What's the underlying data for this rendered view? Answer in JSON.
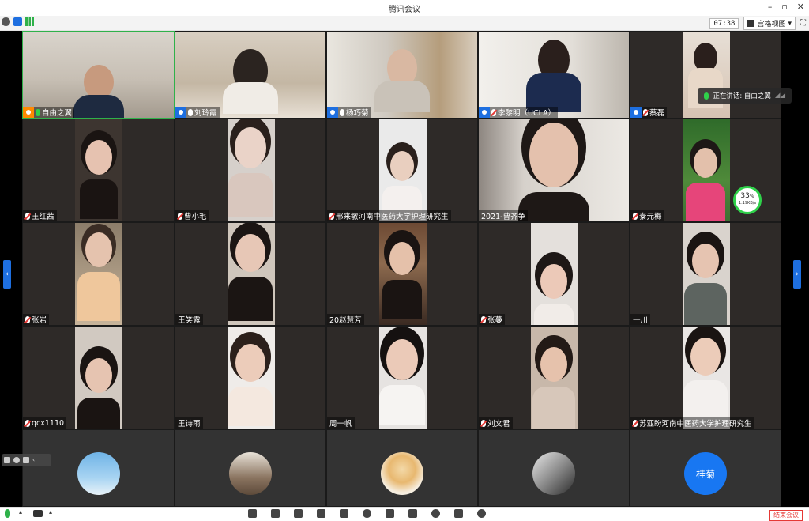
{
  "window": {
    "title": "腾讯会议"
  },
  "toolbar": {
    "time": "07:38",
    "view_label": "宫格视图"
  },
  "speaking": {
    "label": "正在讲话: 自由之翼"
  },
  "tiles": [
    {
      "name": "自由之翼",
      "role": "host",
      "mic": "green"
    },
    {
      "name": "刘玲霞",
      "role": "co",
      "mic": "on"
    },
    {
      "name": "杨巧菊",
      "role": "co",
      "mic": "on"
    },
    {
      "name": "李黎明（UCLA）",
      "role": "co",
      "mic": "muted"
    },
    {
      "name": "蔡磊",
      "role": "co",
      "mic": "muted"
    },
    {
      "name": "王红茜",
      "role": "",
      "mic": "muted"
    },
    {
      "name": "曹小毛",
      "role": "",
      "mic": "muted"
    },
    {
      "name": "邢来敏河南中医药大学护理研究生",
      "role": "",
      "mic": "muted"
    },
    {
      "name": "2021-曹齐争",
      "role": "",
      "mic": ""
    },
    {
      "name": "秦元梅",
      "role": "",
      "mic": "muted"
    },
    {
      "name": "张岩",
      "role": "",
      "mic": "muted"
    },
    {
      "name": "王笑露",
      "role": "",
      "mic": ""
    },
    {
      "name": "20赵慧芳",
      "role": "",
      "mic": ""
    },
    {
      "name": "张蔓",
      "role": "",
      "mic": "muted"
    },
    {
      "name": "一川",
      "role": "",
      "mic": ""
    },
    {
      "name": "qcx1110",
      "role": "",
      "mic": "muted"
    },
    {
      "name": "王诗雨",
      "role": "",
      "mic": ""
    },
    {
      "name": "周一帆",
      "role": "",
      "mic": ""
    },
    {
      "name": "刘文君",
      "role": "",
      "mic": "muted"
    },
    {
      "name": "苏亚盼河南中医药大学护理研究生",
      "role": "",
      "mic": "muted"
    }
  ],
  "avatar_row": [
    {
      "type": "img",
      "icon": "sky-avatar-icon"
    },
    {
      "type": "img",
      "icon": "photo-avatar-icon"
    },
    {
      "type": "img",
      "icon": "cartoon-avatar-icon"
    },
    {
      "type": "img",
      "icon": "bw-avatar-icon"
    },
    {
      "type": "text",
      "text": "桂菊"
    }
  ],
  "network": {
    "percent": "33",
    "unit": "%",
    "speed": "1.19KB/s"
  },
  "bottom": {
    "end_label": "结束会议"
  }
}
